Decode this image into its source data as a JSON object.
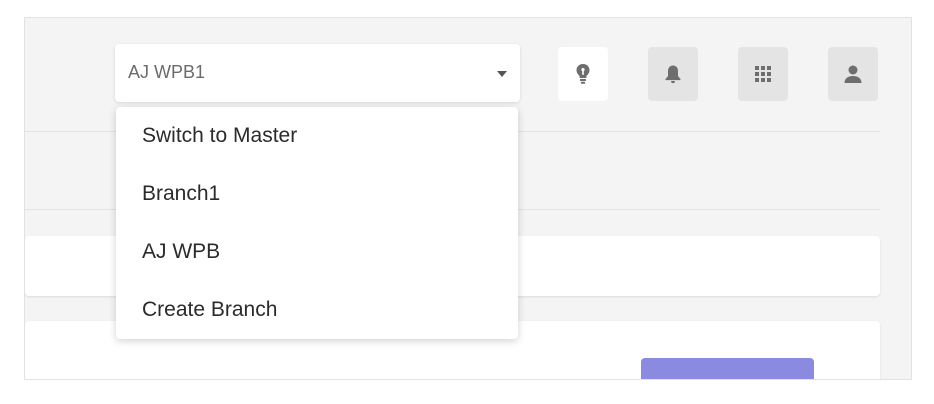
{
  "branch_selector": {
    "value": "AJ WPB1",
    "options": [
      "Switch to Master",
      "Branch1",
      "AJ WPB",
      "Create Branch"
    ]
  },
  "toolbar": {
    "icons": [
      "lightbulb-icon",
      "bell-icon",
      "apps-grid-icon",
      "user-icon"
    ]
  },
  "colors": {
    "accent": "#8a8be0",
    "background": "#f4f4f4",
    "icon_button": "#e4e4e4",
    "icon_glyph": "#6e6e6e"
  }
}
